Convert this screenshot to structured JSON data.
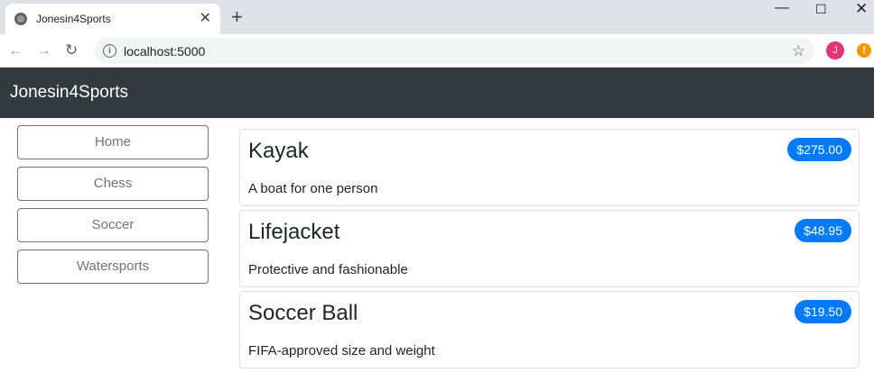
{
  "browser": {
    "tab_title": "Jonesin4Sports",
    "url": "localhost:5000",
    "profile_initial": "J",
    "alert_glyph": "!"
  },
  "navbar": {
    "brand": "Jonesin4Sports"
  },
  "sidebar": {
    "categories": [
      "Home",
      "Chess",
      "Soccer",
      "Watersports"
    ]
  },
  "products": [
    {
      "name": "Kayak",
      "price": "$275.00",
      "description": "A boat for one person"
    },
    {
      "name": "Lifejacket",
      "price": "$48.95",
      "description": "Protective and fashionable"
    },
    {
      "name": "Soccer Ball",
      "price": "$19.50",
      "description": "FIFA-approved size and weight"
    }
  ],
  "colors": {
    "navbar": "#343a40",
    "badge": "#007bff",
    "button_outline": "#6c757d"
  }
}
